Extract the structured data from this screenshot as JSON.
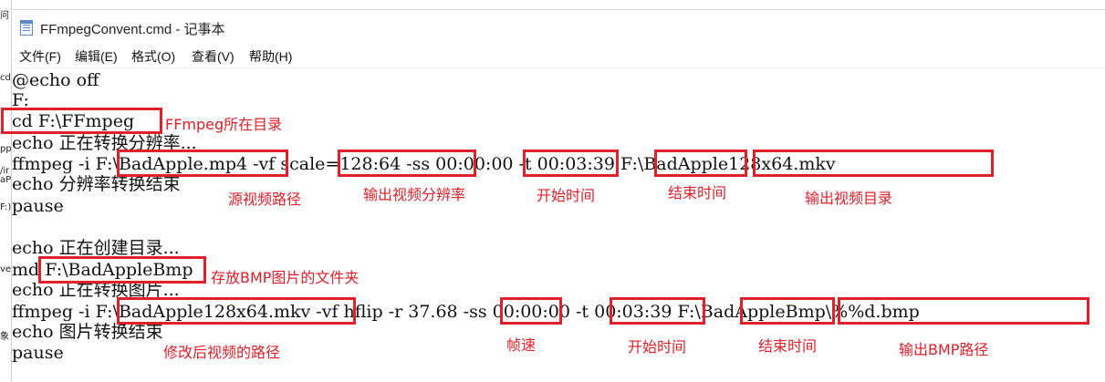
{
  "window": {
    "title": "FFmpegConvent.cmd - 记事本",
    "menu": [
      "文件(F)",
      "编辑(E)",
      "格式(O)",
      "查看(V)",
      "帮助(H)"
    ]
  },
  "left_strip": [
    "问",
    "cd",
    "pp",
    "/ir",
    "aP",
    "F:)",
    "ve",
    "象"
  ],
  "code_lines": [
    "@echo off",
    "F:",
    "cd F:\\FFmpeg",
    "echo 正在转换分辨率...",
    "ffmpeg -i F:\\BadApple.mp4 -vf scale=128:64 -ss 00:00:00 -t 00:03:39 F:\\BadApple128x64.mkv",
    "echo 分辨率转换结束",
    "pause",
    "",
    "echo 正在创建目录...",
    "md F:\\BadAppleBmp",
    "echo 正在转换图片...",
    "ffmpeg -i F:\\BadApple128x64.mkv -vf hflip -r 37.68 -ss 00:00:00 -t 00:03:39 F:\\BadAppleBmp\\%%d.bmp",
    "echo 图片转换结束",
    "pause"
  ],
  "annotations": {
    "ffmpeg_dir": "FFmpeg所在目录",
    "source_path": "源视频路径",
    "output_resolution": "输出视频分辨率",
    "start_time_1": "开始时间",
    "end_time_1": "结束时间",
    "output_video_dir": "输出视频目录",
    "bmp_folder": "存放BMP图片的文件夹",
    "modified_video_path": "修改后视频的路径",
    "frame_rate": "帧速",
    "start_time_2": "开始时间",
    "end_time_2": "结束时间",
    "bmp_output_path": "输出BMP路径"
  },
  "colors": {
    "annotation_red": "#e0202a",
    "icon_blue": "#5a89c7"
  }
}
